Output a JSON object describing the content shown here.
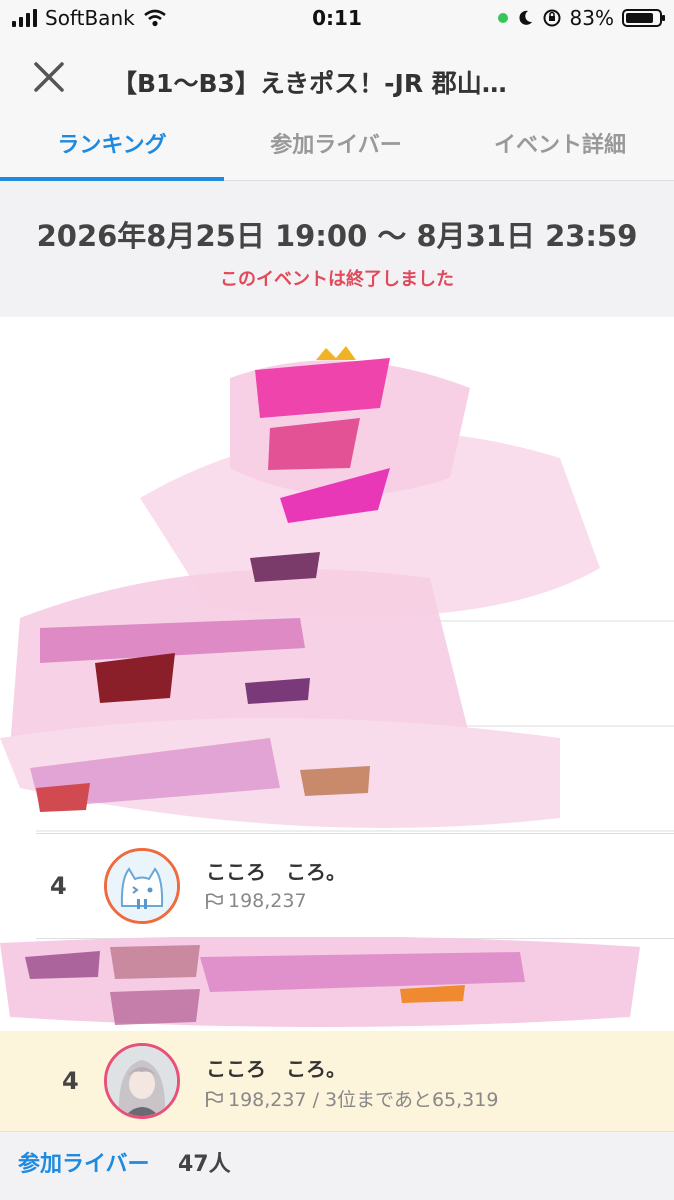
{
  "status_bar": {
    "carrier": "SoftBank",
    "time": "0:11",
    "battery": "83%",
    "battery_level": 0.83
  },
  "header": {
    "title": "【B1〜B3】えきポス！-JR 郡山…",
    "close_icon": "close-icon"
  },
  "tabs": [
    {
      "label": "ランキング",
      "active": true
    },
    {
      "label": "参加ライバー",
      "active": false
    },
    {
      "label": "イベント詳細",
      "active": false
    }
  ],
  "period": {
    "dates": "2026年8月25日 19:00 〜 8月31日 23:59",
    "status": "このイベントは終了しました"
  },
  "ranking": [
    {
      "rank": "4",
      "name": "こころ　ころ。",
      "score": "198,237"
    }
  ],
  "self_entry": {
    "rank": "4",
    "name": "こころ　ころ。",
    "score": "198,237 / 3位まであと65,319"
  },
  "footer": {
    "label": "参加ライバー",
    "count": "47人"
  },
  "colors": {
    "accent": "#1f8be0",
    "alert": "#e04a5a",
    "highlight_bg": "#fdf4dc"
  }
}
